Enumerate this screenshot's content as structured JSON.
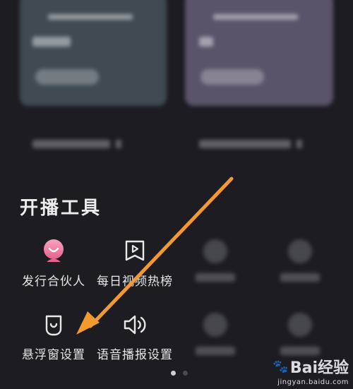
{
  "section": {
    "title": "开播工具"
  },
  "tools_row1": [
    {
      "label": "发行合伙人",
      "icon": "partner-avatar-icon"
    },
    {
      "label": "每日视频热榜",
      "icon": "video-rank-icon"
    }
  ],
  "tools_row2": [
    {
      "label": "悬浮窗设置",
      "icon": "floating-window-icon"
    },
    {
      "label": "语音播报设置",
      "icon": "speaker-icon"
    }
  ],
  "pager": {
    "pages": 2,
    "active": 1
  },
  "watermark": {
    "brand": "Bai经验",
    "site": "jingyan.baidu.com"
  },
  "colors": {
    "background": "#1d1c22",
    "arrow": "#f29a2e",
    "partner_icon": "#f07aa0"
  }
}
